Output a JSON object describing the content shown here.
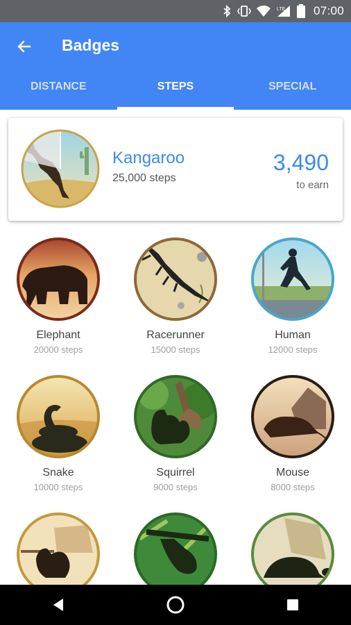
{
  "status_bar": {
    "time": "07:00",
    "icons": [
      "bluetooth-icon",
      "vibrate-icon",
      "wifi-icon",
      "lte-signal-icon",
      "battery-icon"
    ]
  },
  "app_bar": {
    "title": "Badges",
    "back_icon": "arrow-back-icon"
  },
  "tabs": [
    {
      "label": "DISTANCE",
      "active": false
    },
    {
      "label": "STEPS",
      "active": true
    },
    {
      "label": "SPECIAL",
      "active": false
    }
  ],
  "featured": {
    "name": "Kangaroo",
    "steps": "25,000 steps",
    "remaining": "3,490",
    "remaining_label": "to earn",
    "progress": 0.86
  },
  "badges": [
    {
      "name": "Elephant",
      "steps": "20000 steps"
    },
    {
      "name": "Racerunner",
      "steps": "15000 steps"
    },
    {
      "name": "Human",
      "steps": "12000 steps"
    },
    {
      "name": "Snake",
      "steps": "10000 steps"
    },
    {
      "name": "Squirrel",
      "steps": "9000 steps"
    },
    {
      "name": "Mouse",
      "steps": "8000 steps"
    },
    {
      "name": "",
      "steps": ""
    },
    {
      "name": "",
      "steps": ""
    },
    {
      "name": "",
      "steps": ""
    }
  ],
  "colors": {
    "primary": "#4285f4",
    "accent": "#3c8ae8",
    "status_bar": "#5f6368"
  },
  "nav": {
    "back_icon": "nav-back-icon",
    "home_icon": "nav-home-icon",
    "recents_icon": "nav-recents-icon"
  }
}
